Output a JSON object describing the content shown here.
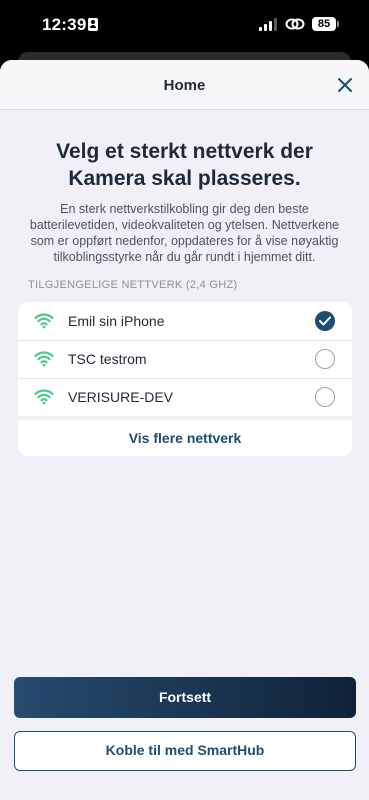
{
  "status_bar": {
    "time": "12:39",
    "battery": "85",
    "icons": [
      "contact-card-icon",
      "cellular-signal-icon",
      "link-icon",
      "battery-icon"
    ]
  },
  "sheet": {
    "title": "Home",
    "close_icon": "close-icon"
  },
  "headline": "Velg et sterkt nettverk der Kamera skal plasseres.",
  "body_text": "En sterk nettverkstilkobling gir deg den beste batterilevetiden, videokvaliteten og ytelsen. Nettverkene som er oppført nedenfor, oppdateres for å vise nøyaktig tilkoblingsstyrke når du går rundt i hjemmet ditt.",
  "networks": {
    "section_label": "TILGJENGELIGE NETTVERK (2,4 GHZ)",
    "items": [
      {
        "name": "Emil sin iPhone",
        "selected": true,
        "icon": "wifi-icon"
      },
      {
        "name": "TSC testrom",
        "selected": false,
        "icon": "wifi-icon"
      },
      {
        "name": "VERISURE-DEV",
        "selected": false,
        "icon": "wifi-icon"
      }
    ],
    "show_more_label": "Vis flere nettverk"
  },
  "actions": {
    "primary_label": "Fortsett",
    "secondary_label": "Koble til med SmartHub"
  },
  "colors": {
    "accent": "#1d4e70",
    "wifi": "#4ecb8a",
    "background": "#f0f0f6"
  }
}
